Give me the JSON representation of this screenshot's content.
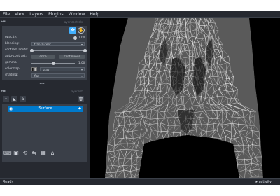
{
  "menu": [
    "File",
    "View",
    "Layers",
    "Plugins",
    "Window",
    "Help"
  ],
  "dock": {
    "controls_title": "layer controls",
    "list_title": "layer list",
    "collapse_glyph": "▸▪"
  },
  "controls": {
    "opacity": {
      "label": "opacity:",
      "value": "1.00",
      "level": 1.0
    },
    "blending": {
      "label": "blending:",
      "value": "translucent"
    },
    "contrast_limits": {
      "label": "contrast limits:",
      "low": 0.0,
      "high": 1.0
    },
    "auto_contrast": {
      "label": "auto-contrast:",
      "once": "once",
      "continuous": "continuous"
    },
    "gamma": {
      "label": "gamma:",
      "value": "1.00",
      "level": 0.5
    },
    "colormap": {
      "label": "colormap:",
      "value": "gray"
    },
    "shading": {
      "label": "shading:",
      "value": "flat"
    }
  },
  "layers": [
    {
      "name": "Surface",
      "visible": true,
      "selected": true
    }
  ],
  "status": {
    "text": "Ready",
    "activity": "activity"
  },
  "colors": {
    "background": "#262930",
    "panel": "#3a3f48",
    "selection": "#007acc",
    "accent": "#42b0ff",
    "canvas": "#000000"
  }
}
